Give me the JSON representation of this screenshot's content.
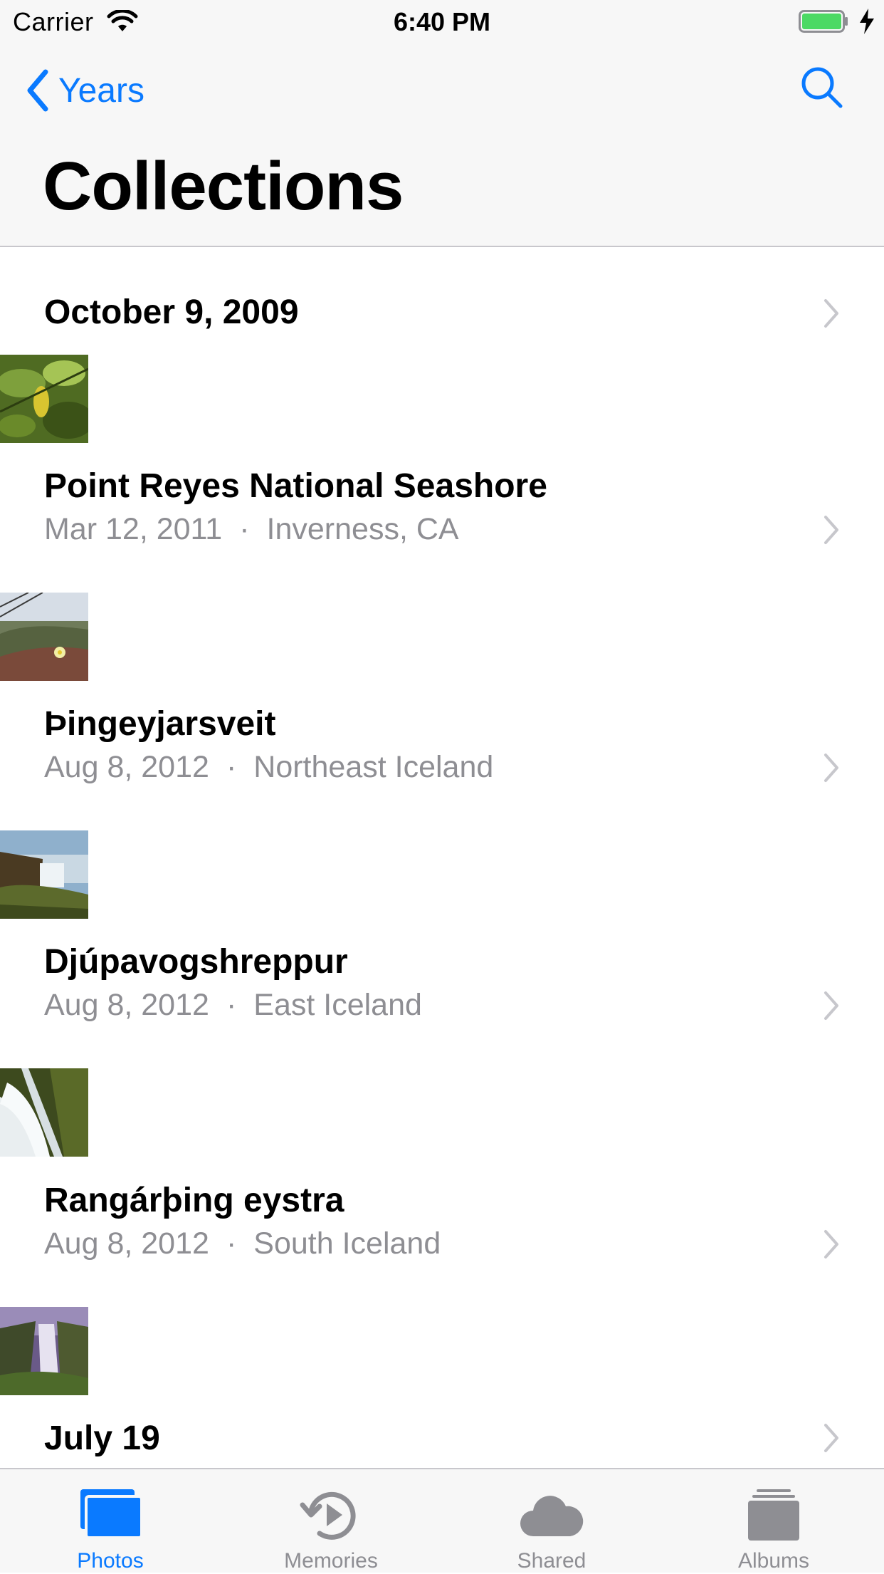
{
  "status_bar": {
    "carrier": "Carrier",
    "time": "6:40 PM",
    "battery_color": "#4cd964"
  },
  "nav": {
    "back_label": "Years",
    "title": "Collections"
  },
  "colors": {
    "accent": "#0a7aff",
    "secondary_text": "#8e8e93",
    "bar_background": "#f7f7f7"
  },
  "moments": [
    {
      "title": "October 9, 2009",
      "date": "",
      "location": "",
      "thumb": "green-leaves"
    },
    {
      "title": "Point Reyes National Seashore",
      "date": "Mar 12, 2011",
      "location": "Inverness, CA",
      "thumb": "coastal-flower"
    },
    {
      "title": "Þingeyjarsveit",
      "date": "Aug 8, 2012",
      "location": "Northeast Iceland",
      "thumb": "waterfall-canyon"
    },
    {
      "title": "Djúpavogshreppur",
      "date": "Aug 8, 2012",
      "location": "East Iceland",
      "thumb": "white-waterfall"
    },
    {
      "title": "Rangárþing eystra",
      "date": "Aug 8, 2012",
      "location": "South Iceland",
      "thumb": "purple-waterfall"
    },
    {
      "title": "July 19",
      "date": "",
      "location": "",
      "thumb": ""
    }
  ],
  "tabs": [
    {
      "label": "Photos",
      "icon": "photos-icon",
      "active": true
    },
    {
      "label": "Memories",
      "icon": "memories-icon",
      "active": false
    },
    {
      "label": "Shared",
      "icon": "cloud-icon",
      "active": false
    },
    {
      "label": "Albums",
      "icon": "albums-icon",
      "active": false
    }
  ],
  "separator_dot": "·"
}
